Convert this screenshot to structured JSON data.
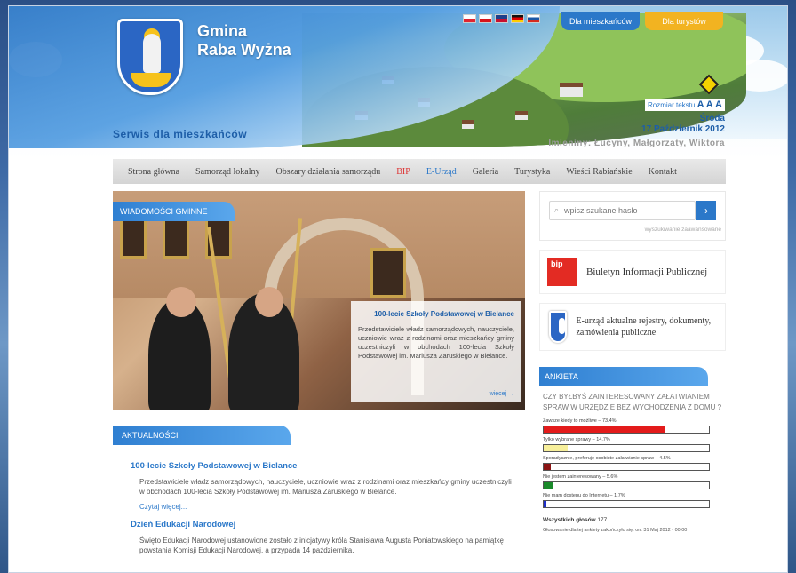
{
  "header": {
    "title_line1": "Gmina",
    "title_line2": "Raba Wyżna",
    "tagline": "Serwis dla mieszkańców",
    "tab_residents": "Dla mieszkańców",
    "tab_tourists": "Dla turystów",
    "text_size_label": "Rozmiar tekstu",
    "text_size_letters": "A A A",
    "day": "Środa",
    "date": "17 Październik 2012",
    "namedays": "Imieniny: Łucyny, Małgorzaty, Wiktora",
    "flags": [
      {
        "name": "flag-pl",
        "top": "#ffffff",
        "bottom": "#e0242f"
      },
      {
        "name": "flag-cz",
        "top": "#ffffff",
        "bottom": "#d7141a"
      },
      {
        "name": "flag-uk",
        "top": "#1f3f8a",
        "bottom": "#c8102e"
      },
      {
        "name": "flag-de",
        "top": "#111111",
        "bottom": "#ffce00"
      },
      {
        "name": "flag-ru",
        "top": "#ffffff",
        "bottom": "#1c57a5"
      }
    ]
  },
  "nav": {
    "items": [
      "Strona główna",
      "Samorząd lokalny",
      "Obszary działania samorządu",
      "BIP",
      "E-Urząd",
      "Galeria",
      "Turystyka",
      "Wieści Rabiańskie",
      "Kontakt"
    ]
  },
  "feature": {
    "section_label": "WIADOMOŚCI GMINNE",
    "caption_title": "100-lecie Szkoły Podstawowej w Bielance",
    "caption_text": "Przedstawiciele władz samorządowych, nauczyciele, uczniowie wraz z rodzinami oraz mieszkańcy gminy uczestniczyli w obchodach 100-lecia Szkoły Podstawowej im. Mariusza Zaruskiego w Bielance.",
    "caption_more": "więcej →"
  },
  "news": {
    "section_label": "AKTUALNOŚCI",
    "items": [
      {
        "title": "100-lecie Szkoły Podstawowej w Bielance",
        "text": "Przedstawiciele władz samorządowych, nauczyciele, uczniowie wraz z rodzinami oraz mieszkańcy gminy uczestniczyli w obchodach 100-lecia Szkoły Podstawowej im. Mariusza Zaruskiego w Bielance.",
        "read_more": "Czytaj więcej..."
      },
      {
        "title": "Dzień Edukacji Narodowej",
        "text": "Święto Edukacji Narodowej ustanowione zostało z inicjatywy króla Stanisława Augusta Poniatowskiego na pamiątkę powstania Komisji Edukacji Narodowej, a przypada 14 października."
      }
    ]
  },
  "sidebar": {
    "search_placeholder": "wpisz szukane hasło",
    "search_icon": "magnifier-icon",
    "search_button": "›",
    "advanced_search": "wyszukiwanie zaawansowane",
    "bip_logo": "bip",
    "bip_title": "Biuletyn Informacji Publicznej",
    "eurzad_title": "E-urząd aktualne rejestry, dokumenty, zamówienia publiczne"
  },
  "poll": {
    "section_label": "ANKIETA",
    "question": "CZY BYŁBYŚ ZAINTERESOWANY ZAŁATWIANIEM SPRAW W URZĘDZIE BEZ WYCHODZENIA Z DOMU ?",
    "options": [
      {
        "label": "Zawsze kiedy to możliwe – 73.4%",
        "percent": 73.4,
        "color": "#e31b1b"
      },
      {
        "label": "Tylko wybrane sprawy – 14.7%",
        "percent": 14.7,
        "color": "#f7ef9a"
      },
      {
        "label": "Sporadycznie, preferuję osobiste załatwianie spraw – 4.5%",
        "percent": 4.5,
        "color": "#8b1414"
      },
      {
        "label": "Nie jestem zainteresowany – 5.6%",
        "percent": 5.6,
        "color": "#1a8a2a"
      },
      {
        "label": "Nie mam dostępu do Internetu – 1.7%",
        "percent": 1.7,
        "color": "#1f2fc8"
      }
    ],
    "total_label": "Wszystkich głosów",
    "total_value": "177",
    "note": "Głosowanie dla tej ankiety zakończyło się: on: 31 Maj 2012 - 00:00"
  }
}
